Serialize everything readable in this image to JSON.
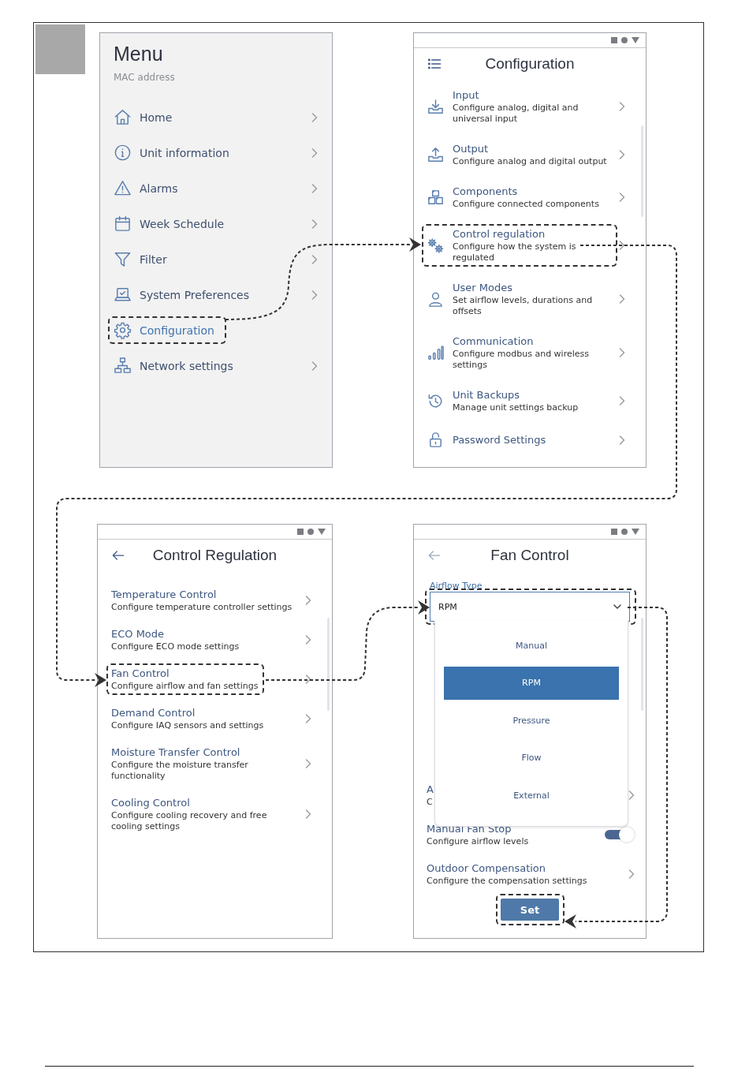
{
  "screens": [
    {
      "kind": "menu",
      "title": "Menu",
      "subtitle": "MAC address",
      "items": [
        {
          "label": "Home",
          "chevron": true,
          "highlighted": false
        },
        {
          "label": "Unit information",
          "chevron": true,
          "highlighted": false
        },
        {
          "label": "Alarms",
          "chevron": true,
          "highlighted": false
        },
        {
          "label": "Week Schedule",
          "chevron": true,
          "highlighted": false
        },
        {
          "label": "Filter",
          "chevron": true,
          "highlighted": false
        },
        {
          "label": "System Preferences",
          "chevron": true,
          "highlighted": false
        },
        {
          "label": "Configuration",
          "chevron": false,
          "highlighted": true
        },
        {
          "label": "Network settings",
          "chevron": true,
          "highlighted": false
        }
      ]
    },
    {
      "kind": "list",
      "nav_button": {
        "kind": "menu"
      },
      "title": "Configuration",
      "icons": true,
      "items": [
        {
          "title": "Input",
          "subtitle": "Configure analog, digital and universal input",
          "chevron": true,
          "highlighted": false
        },
        {
          "title": "Output",
          "subtitle": "Configure analog and digital output",
          "chevron": true,
          "highlighted": false
        },
        {
          "title": "Components",
          "subtitle": "Configure connected components",
          "chevron": true,
          "highlighted": false
        },
        {
          "title": "Control regulation",
          "subtitle": "Configure how the system is regulated",
          "chevron": true,
          "highlighted": true
        },
        {
          "title": "User Modes",
          "subtitle": "Set airflow levels, durations and offsets",
          "chevron": true,
          "highlighted": false
        },
        {
          "title": "Communication",
          "subtitle": "Configure modbus and wireless settings",
          "chevron": true,
          "highlighted": false
        },
        {
          "title": "Unit Backups",
          "subtitle": "Manage unit settings backup",
          "chevron": true,
          "highlighted": false
        },
        {
          "title": "Password Settings",
          "chevron": true,
          "highlighted": false
        }
      ]
    },
    {
      "kind": "list",
      "nav_button": {
        "kind": "back"
      },
      "title": "Control Regulation",
      "icons": false,
      "items": [
        {
          "title": "Temperature Control",
          "subtitle": "Configure temperature controller settings",
          "chevron": true,
          "highlighted": false
        },
        {
          "title": "ECO Mode",
          "subtitle": "Configure ECO mode settings",
          "chevron": true,
          "highlighted": false
        },
        {
          "title": "Fan Control",
          "subtitle": "Configure airflow and fan settings",
          "chevron": true,
          "highlighted": true
        },
        {
          "title": "Demand Control",
          "subtitle": "Configure IAQ sensors and settings",
          "chevron": true,
          "highlighted": false
        },
        {
          "title": "Moisture Transfer Control",
          "subtitle": "Configure the moisture transfer functionality",
          "chevron": true,
          "highlighted": false
        },
        {
          "title": "Cooling Control",
          "subtitle": "Configure cooling recovery and free cooling settings",
          "chevron": true,
          "highlighted": false
        }
      ]
    },
    {
      "kind": "form",
      "nav_button": {
        "kind": "back"
      },
      "title": "Fan Control",
      "field": {
        "label": "Airflow Type",
        "value": "RPM",
        "highlighted": true
      },
      "dropdown": {
        "options": [
          {
            "label": "Manual",
            "selected": false
          },
          {
            "label": "RPM",
            "selected": true
          },
          {
            "label": "Pressure",
            "selected": false
          },
          {
            "label": "Flow",
            "selected": false
          },
          {
            "label": "External",
            "selected": false
          }
        ]
      },
      "items": [
        {
          "kind": "link",
          "title": "A",
          "subtitle": "C",
          "chevron": true
        },
        {
          "kind": "toggle",
          "title": "Manual Fan Stop",
          "subtitle": "Configure airflow levels",
          "on": true
        },
        {
          "kind": "link",
          "title": "Outdoor Compensation",
          "subtitle": "Configure the compensation settings",
          "chevron": true
        }
      ],
      "button": {
        "label": "Set",
        "highlighted": true
      }
    }
  ]
}
